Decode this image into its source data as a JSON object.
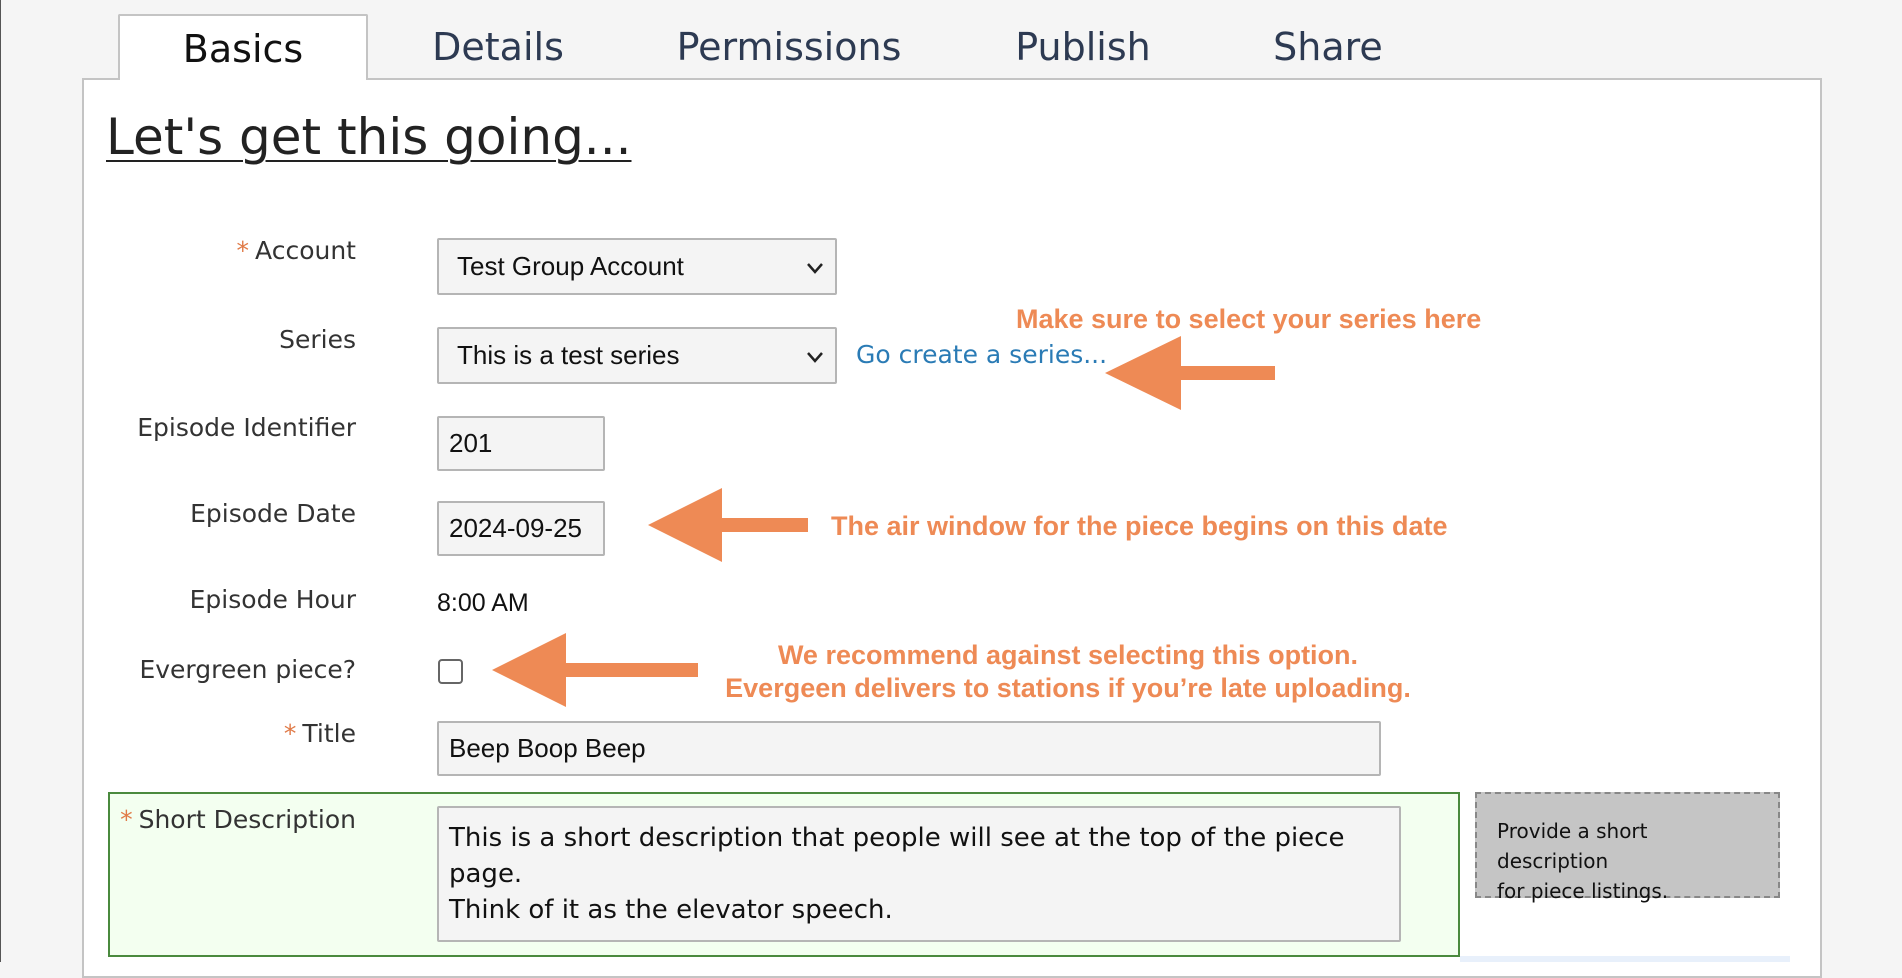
{
  "tabs": [
    {
      "label": "Basics",
      "active": true
    },
    {
      "label": "Details",
      "active": false
    },
    {
      "label": "Permissions",
      "active": false
    },
    {
      "label": "Publish",
      "active": false
    },
    {
      "label": "Share",
      "active": false
    }
  ],
  "page_title": "Let's get this going...",
  "form": {
    "required_marker": "*",
    "account": {
      "label": "Account",
      "value": "Test Group Account"
    },
    "series": {
      "label": "Series",
      "value": "This is a test series",
      "link": "Go create a series..."
    },
    "episode_identifier": {
      "label": "Episode Identifier",
      "value": "201"
    },
    "episode_date": {
      "label": "Episode Date",
      "value": "2024-09-25"
    },
    "episode_hour": {
      "label": "Episode Hour",
      "value": "8:00 AM"
    },
    "evergreen": {
      "label": "Evergreen piece?",
      "checked": false
    },
    "title": {
      "label": "Title",
      "value": "Beep Boop Beep"
    },
    "short_description": {
      "label": "Short Description",
      "line1": "This is a short description that people will see at the top of the piece page.",
      "line2": "Think of it as the elevator speech.",
      "hint_line1": "Provide a short description",
      "hint_line2": "for piece listings."
    }
  },
  "annotations": {
    "series_note": "Make sure to select your series here",
    "date_note": "The air window for the piece begins on this date",
    "evergreen_note_line1": "We recommend against selecting this option.",
    "evergreen_note_line2": "Evergeen delivers to stations if you’re late uploading.",
    "color": "#ee8a55"
  },
  "colors": {
    "accent_link": "#2a7bb5",
    "required": "#e07a47",
    "valid_border": "#4a8a3e",
    "valid_bg": "#f3fff0"
  }
}
